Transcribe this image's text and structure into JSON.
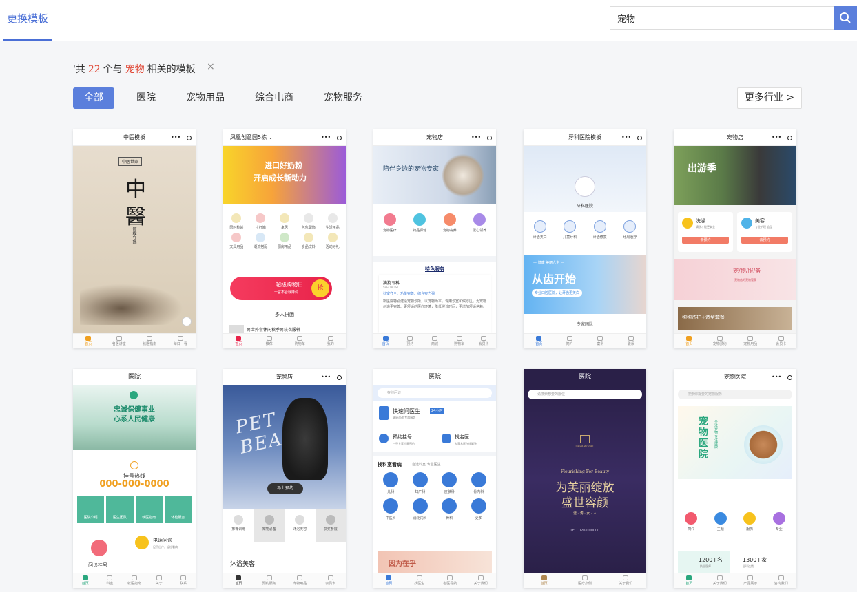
{
  "header": {
    "tab_label": "更换模板",
    "search_value": "宠物"
  },
  "result": {
    "prefix": "'共",
    "count": "22",
    "middle": "个与",
    "keyword": "宠物",
    "suffix": "相关的模板",
    "clear": "×"
  },
  "filters": [
    "全部",
    "医院",
    "宠物用品",
    "综合电商",
    "宠物服务"
  ],
  "more_industry": "更多行业 >",
  "cards": [
    {
      "title": "中医模板",
      "badge": "中医世家",
      "big1": "中",
      "big2": "醫",
      "vert": "簡樸守拙",
      "tabs": [
        "首页",
        "名医讲堂",
        "就医指南",
        "每日一看"
      ]
    },
    {
      "title": "凤凰创意园5栋 ⌄",
      "banner1": "进口好奶粉",
      "banner2": "开启成长新动力",
      "icons": [
        "限时秒杀",
        "拉杆箱",
        "家居",
        "包包配饰",
        "生活用品",
        "文具用品",
        "潮流搭配",
        "厨房用品",
        "食品饮料",
        "活动好礼"
      ],
      "promo": "超级购物日",
      "promo_sub": "一言不合就降价",
      "promo_btn": "抢",
      "section": "多人拼团",
      "item": "男士外套休闲秋季男装衣服韩",
      "tabs": [
        "首页",
        "推荐",
        "购物车",
        "我的"
      ]
    },
    {
      "title": "宠物店",
      "hero": "陪伴身边的宠物专家",
      "icons": [
        "宠物医疗",
        "药品保健",
        "宠物寄养",
        "爱心领养"
      ],
      "section": "特色服务",
      "sub_title": "猫狗专科",
      "sub_en": "SPECIALIST",
      "sub_tag": "科室齐全、功能完善、综合实力强",
      "desc": "新医院特别建设宠物诊所，以宠物为本，专用诊室和候诊区，为宠物创造更完善、更舒适的医疗环境，降低候诊时间，更增加舒适信赖。",
      "tabs": [
        "首页",
        "预约",
        "商城",
        "购物车",
        "会员卡"
      ]
    },
    {
      "title": "牙科医院模板",
      "hero_label": "牙科医院",
      "icons": [
        "牙齿美白",
        "儿童牙科",
        "牙齿修复",
        "牙周治疗"
      ],
      "banner_small": "— 健康 美丽人生 —",
      "banner_big": "从齿开始",
      "banner_btn": "专业口腔医院，让牙齿更美白",
      "section": "专家团队",
      "tabs": [
        "首页",
        "简介",
        "案例",
        "联系"
      ]
    },
    {
      "title": "宠物店",
      "hero_text": "出游季",
      "svc1": "洗澡",
      "svc1_desc": "请洗才能更安全",
      "svc2": "美容",
      "svc2_desc": "专业护理 造型",
      "btn": "去预约",
      "banner": "宠/物/服/务",
      "banner_sub": "宠物店的宠物管家",
      "strip": "狗狗洗护+造型套餐",
      "tabs": [
        "首页",
        "宠物预约",
        "宠物用品",
        "会员卡"
      ]
    },
    {
      "title": "医院",
      "banner1": "忠诚保健事业",
      "banner2": "心系人民健康",
      "hotline_label": "挂号热线",
      "hotline": "000-000-0000",
      "btns": [
        "医院介绍",
        "医生团队",
        "就医指南",
        "体检服务"
      ],
      "item1": "问诊挂号",
      "item2": "电话问诊",
      "item2_desc": "足不出户，轻松看病",
      "tabs": [
        "首页",
        "科室",
        "就医指南",
        "关于",
        "联系"
      ]
    },
    {
      "title": "宠物店",
      "hero": "PET BEAUTY",
      "btn": "马上预约",
      "icons": [
        "推荐训练",
        "宠物必备",
        "沐浴美容",
        "获奖参展"
      ],
      "section": "沐浴美容",
      "tabs": [
        "首页",
        "预约服务",
        "宠物用品",
        "会员卡"
      ]
    },
    {
      "title": "医院",
      "search": "在线问诊",
      "quick": "快速问医生",
      "quick_tag": "24小时",
      "quick_sub": "健康咨询 专属服务",
      "reg": "预约挂号",
      "reg_sub": "三甲专家特需预约",
      "doc": "找名医",
      "doc_sub": "专家名医在线解答",
      "section": "找科室看病",
      "section_sub": "自选科室 专业医生",
      "depts": [
        "儿科",
        "妇产科",
        "皮肤科",
        "骨内科",
        "中医科",
        "消化内科",
        "骨科",
        "更多"
      ],
      "banner": "因为在乎",
      "tabs": [
        "首页",
        "找医生",
        "名医导航",
        "关于我们"
      ]
    },
    {
      "title": "医院",
      "search": "请搜索想要的部位",
      "logo_small": "DREAM GOAL",
      "tagline": "Flourishing For Beauty",
      "big1": "为美丽绽放",
      "big2": "盛世容颜",
      "sub": "澄 · 涛 · 女 · 人",
      "phone": "TEL: 020-000000",
      "tabs": [
        "首页",
        "医疗案例",
        "关于我们"
      ]
    },
    {
      "title": "宠物医院",
      "search": "搜索你需要的宠物服务",
      "hero": "宠物医院",
      "hero_side": "关注宠物 专注健康",
      "icons": [
        "简介",
        "主题",
        "服务",
        "专业"
      ],
      "stat1": "1200+名",
      "stat1_sub": "执业医师",
      "stat2": "1300+家",
      "stat2_sub": "全球连锁",
      "tabs": [
        "首页",
        "关于我们",
        "产品展示",
        "咨询我们"
      ]
    }
  ]
}
